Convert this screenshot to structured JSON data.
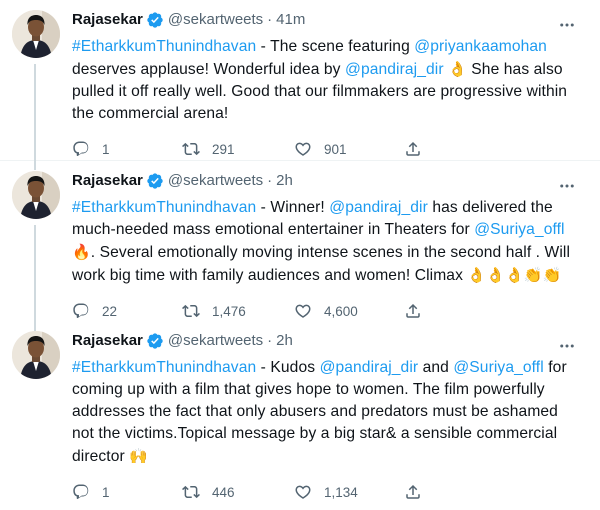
{
  "tweets": [
    {
      "author_name": "Rajasekar",
      "author_handle": "@sekartweets",
      "separator": "·",
      "time": "41m",
      "segments": [
        {
          "t": "#EtharkkumThunindhavan",
          "link": true
        },
        {
          "t": " - The scene featuring ",
          "link": false
        },
        {
          "t": "@priyankaamohan",
          "link": true
        },
        {
          "t": " deserves applause! Wonderful idea by ",
          "link": false
        },
        {
          "t": "@pandiraj_dir",
          "link": true
        },
        {
          "t": " ",
          "link": false
        },
        {
          "t": "👌",
          "emoji": true
        },
        {
          "t": " She has also pulled it off really well. Good that our filmmakers are progressive within the commercial arena!",
          "link": false
        }
      ],
      "replies": "1",
      "retweets": "291",
      "likes": "901"
    },
    {
      "author_name": "Rajasekar",
      "author_handle": "@sekartweets",
      "separator": "·",
      "time": "2h",
      "segments": [
        {
          "t": "#EtharkkumThunindhavan",
          "link": true
        },
        {
          "t": " - Winner! ",
          "link": false
        },
        {
          "t": "@pandiraj_dir",
          "link": true
        },
        {
          "t": " has delivered the much-needed mass emotional entertainer in Theaters for ",
          "link": false
        },
        {
          "t": "@Suriya_offl",
          "link": true
        },
        {
          "t": " ",
          "link": false
        },
        {
          "t": "🔥",
          "emoji": true,
          "fire": true
        },
        {
          "t": ". Several emotionally moving intense scenes in the second half . Will work big time with family audiences and women! Climax ",
          "link": false
        },
        {
          "t": "👌👌👌👏👏",
          "emoji": true
        }
      ],
      "replies": "22",
      "retweets": "1,476",
      "likes": "4,600"
    },
    {
      "author_name": "Rajasekar",
      "author_handle": "@sekartweets",
      "separator": "·",
      "time": "2h",
      "segments": [
        {
          "t": "#EtharkkumThunindhavan",
          "link": true
        },
        {
          "t": " - Kudos ",
          "link": false
        },
        {
          "t": "@pandiraj_dir",
          "link": true
        },
        {
          "t": " and ",
          "link": false
        },
        {
          "t": "@Suriya_offl",
          "link": true
        },
        {
          "t": " for coming up with a film that gives hope to women. The film powerfully addresses the fact that only abusers and predators must be ashamed not the victims.Topical message by a big star& a sensible commercial director ",
          "link": false
        },
        {
          "t": "🙌",
          "emoji": true
        }
      ],
      "replies": "1",
      "retweets": "446",
      "likes": "1,134"
    }
  ],
  "colors": {
    "link": "#1d9bf0",
    "muted": "#536471",
    "text": "#0f1419",
    "verified": "#1d9bf0"
  },
  "icons": [
    "verified-badge-icon",
    "more-options-icon",
    "reply-icon",
    "retweet-icon",
    "like-icon",
    "share-icon"
  ]
}
